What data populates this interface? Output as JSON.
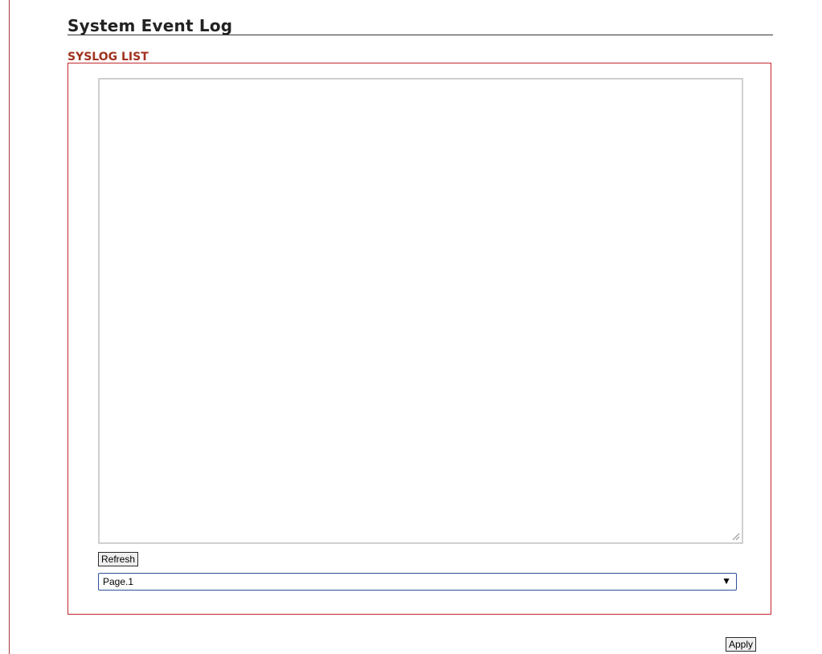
{
  "page": {
    "title": "System Event Log"
  },
  "syslog": {
    "section_label": "SYSLOG LIST",
    "log_text": "",
    "refresh_label": "Refresh",
    "page_select": {
      "selected": "Page.1",
      "arrow_icon": "triangle-down-icon"
    }
  },
  "footer": {
    "apply_label": "Apply"
  },
  "colors": {
    "section_label": "#a0321e",
    "panel_border": "#c0282d",
    "left_rule": "#a33a3a",
    "select_border": "#2f4f9a"
  }
}
